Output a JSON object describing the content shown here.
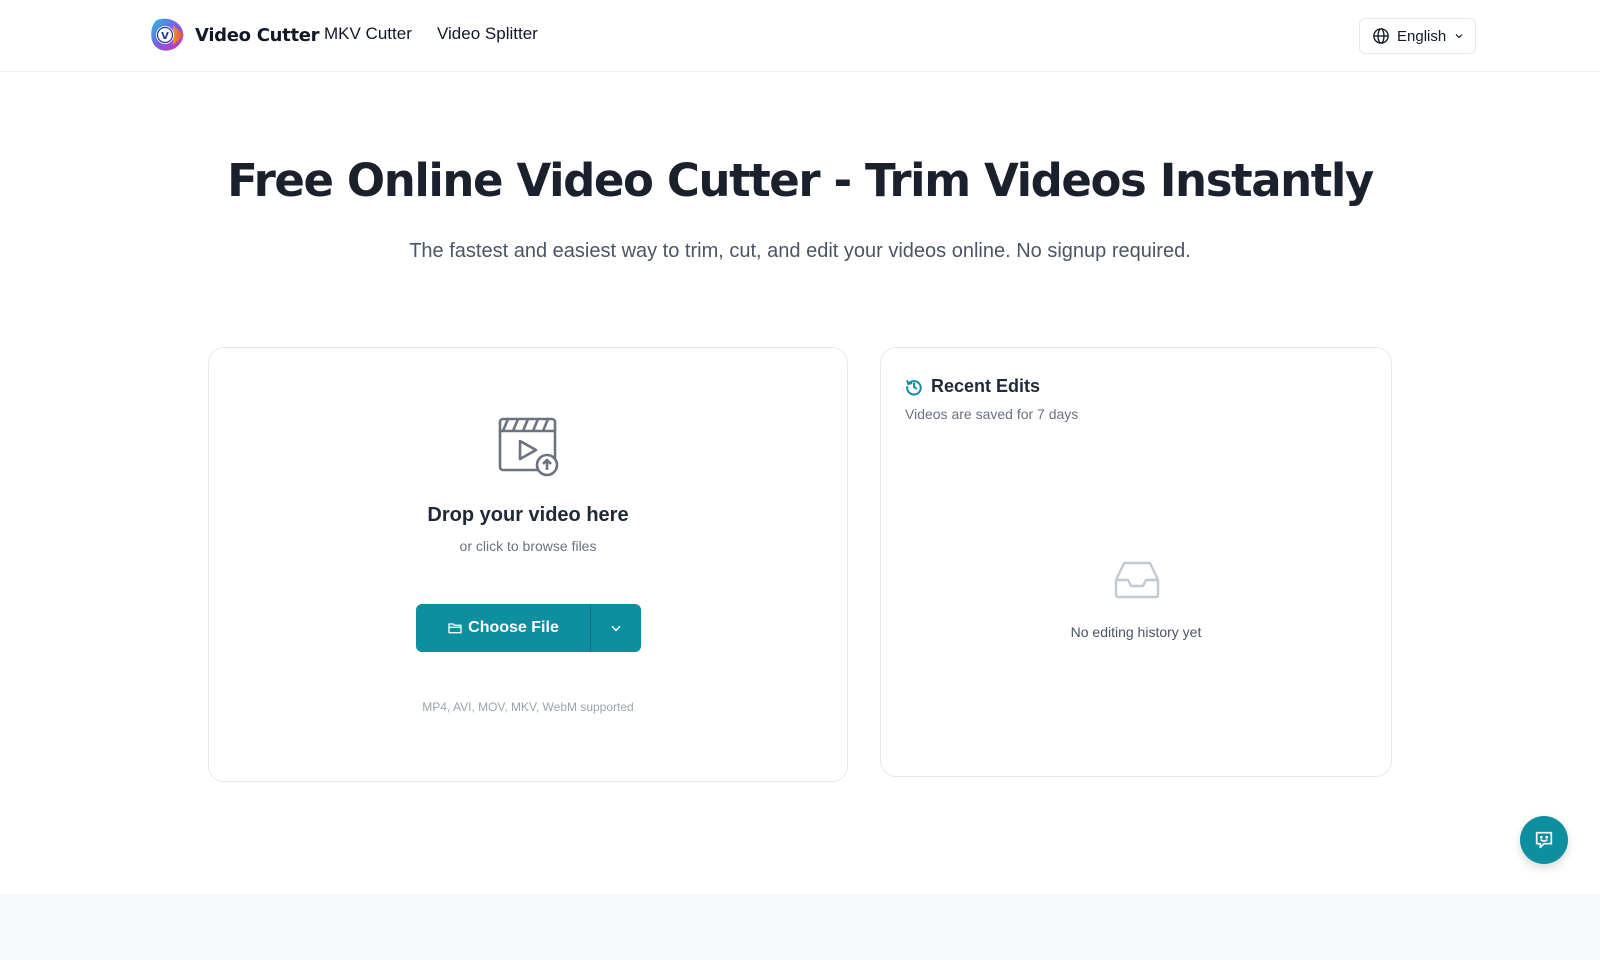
{
  "header": {
    "brand_name": "Video Cutter",
    "nav": [
      {
        "label": "MKV Cutter"
      },
      {
        "label": "Video Splitter"
      }
    ],
    "language": "English"
  },
  "hero": {
    "title": "Free Online Video Cutter - Trim Videos Instantly",
    "subtitle": "The fastest and easiest way to trim, cut, and edit your videos online. No signup required."
  },
  "upload": {
    "title": "Drop your video here",
    "subtitle": "or click to browse files",
    "choose_label": "Choose File",
    "formats": "MP4, AVI, MOV, MKV, WebM supported"
  },
  "recent": {
    "title": "Recent Edits",
    "subtitle": "Videos are saved for 7 days",
    "empty": "No editing history yet"
  },
  "colors": {
    "accent": "#0e8fa0",
    "heading": "#1a202c",
    "muted": "#6b7280"
  },
  "icons": {
    "logo": "video-cutter-logo",
    "language": "globe-icon",
    "upload": "video-upload-icon",
    "folder": "folder-icon",
    "history": "history-icon",
    "empty": "inbox-icon",
    "chat": "chat-icon"
  }
}
